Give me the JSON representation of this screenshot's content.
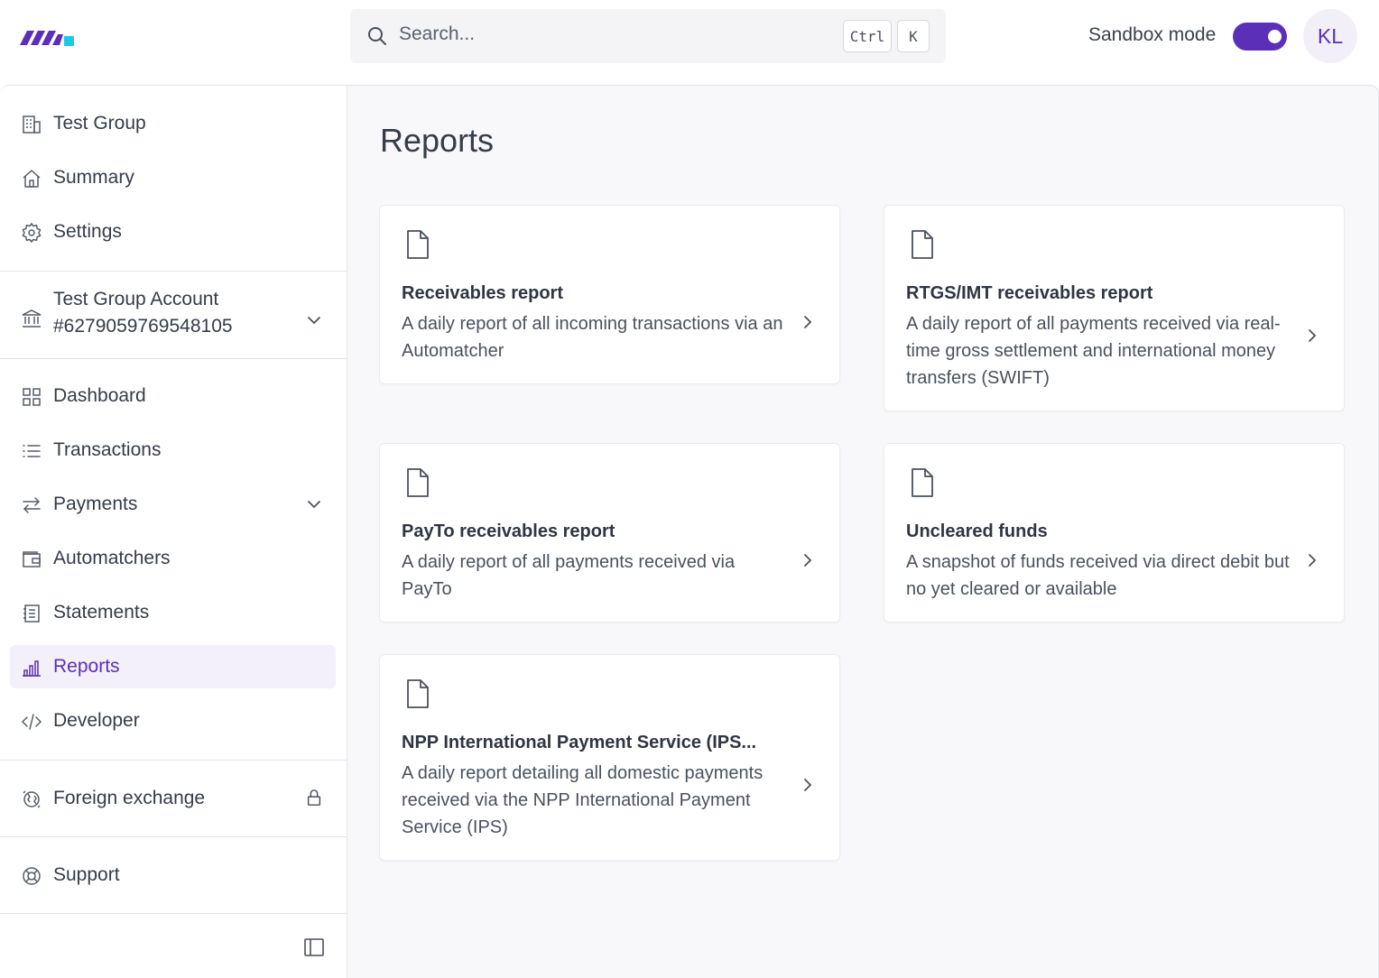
{
  "header": {
    "search_placeholder": "Search...",
    "shortcut_ctrl": "Ctrl",
    "shortcut_key": "K",
    "sandbox_label": "Sandbox mode",
    "sandbox_enabled": true,
    "avatar_initials": "KL",
    "brand_color": "#5b2fb8",
    "logo_accent_color": "#1ec8e8"
  },
  "sidebar": {
    "group": [
      {
        "label": "Test Group",
        "icon": "building-icon"
      },
      {
        "label": "Summary",
        "icon": "home-icon"
      },
      {
        "label": "Settings",
        "icon": "gear-icon"
      }
    ],
    "account": {
      "name": "Test Group Account",
      "number": "#6279059769548105",
      "icon": "bank-icon"
    },
    "items": [
      {
        "label": "Dashboard",
        "icon": "grid-icon"
      },
      {
        "label": "Transactions",
        "icon": "list-icon"
      },
      {
        "label": "Payments",
        "icon": "arrows-icon",
        "expandable": true
      },
      {
        "label": "Automatchers",
        "icon": "wallet-icon"
      },
      {
        "label": "Statements",
        "icon": "statement-icon"
      },
      {
        "label": "Reports",
        "icon": "bar-chart-icon",
        "active": true
      },
      {
        "label": "Developer",
        "icon": "code-icon"
      }
    ],
    "foreign_exchange": {
      "label": "Foreign exchange",
      "icon": "globe-icon",
      "locked": true
    },
    "support": {
      "label": "Support",
      "icon": "lifebuoy-icon"
    }
  },
  "main": {
    "title": "Reports",
    "cards": [
      {
        "title": "Receivables report",
        "desc": "A daily report of all incoming transactions via an Automatcher"
      },
      {
        "title": "RTGS/IMT receivables report",
        "desc": "A daily report of all payments received via real-time gross settlement and international money transfers (SWIFT)"
      },
      {
        "title": "PayTo receivables report",
        "desc": "A daily report of all payments received via PayTo"
      },
      {
        "title": "Uncleared funds",
        "desc": "A snapshot of funds received via direct debit but no yet cleared or available"
      },
      {
        "title": "NPP International Payment Service (IPS...",
        "desc": "A daily report detailing all domestic payments received via the NPP International Payment Service (IPS)"
      }
    ]
  }
}
